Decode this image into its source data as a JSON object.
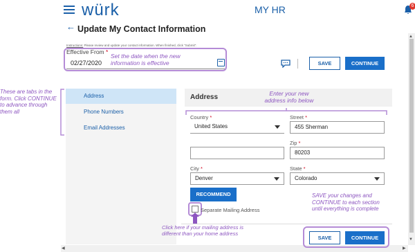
{
  "header": {
    "logo": "würk",
    "app_title": "MY HR",
    "notification_count": "6"
  },
  "page": {
    "back_icon": "←",
    "title": "Update My Contact Information",
    "instructions_prefix": "Instructions:",
    "instructions": "Please review and update your contact information. When finished, click \"Submit\"."
  },
  "effective": {
    "label": "Effective From",
    "required": "*",
    "value": "02/27/2020"
  },
  "toolbar": {
    "save_label": "SAVE",
    "continue_label": "CONTINUE"
  },
  "tabs": [
    {
      "label": "Address"
    },
    {
      "label": "Phone Numbers"
    },
    {
      "label": "Email Addresses"
    }
  ],
  "form": {
    "header": "Address",
    "country_label": "Country",
    "country_value": "United States",
    "street_label": "Street",
    "street_value": "455 Sherman",
    "street2_value": "",
    "zip_label": "Zip",
    "zip_value": "80203",
    "city_label": "City",
    "city_value": "Denver",
    "state_label": "State",
    "state_value": "Colorado",
    "required": "*",
    "recommend_label": "RECOMMEND",
    "separate_label": "Separate Mailing Address"
  },
  "footer": {
    "save_label": "SAVE",
    "continue_label": "CONTINUE"
  },
  "annotations": {
    "date": "Set the date when the new information is effective",
    "address": "Enter your new address info below",
    "tabs": "These are tabs in the form. Click CONTINUE to advance through them all",
    "save": "SAVE your changes and CONTINUE to each section until everything is complete",
    "mailing": "Click here if your mailing address is different than your home address"
  },
  "colors": {
    "brand": "#1a5fa8",
    "annotation": "#8d56c0",
    "accent_button": "#1a6fc9"
  }
}
